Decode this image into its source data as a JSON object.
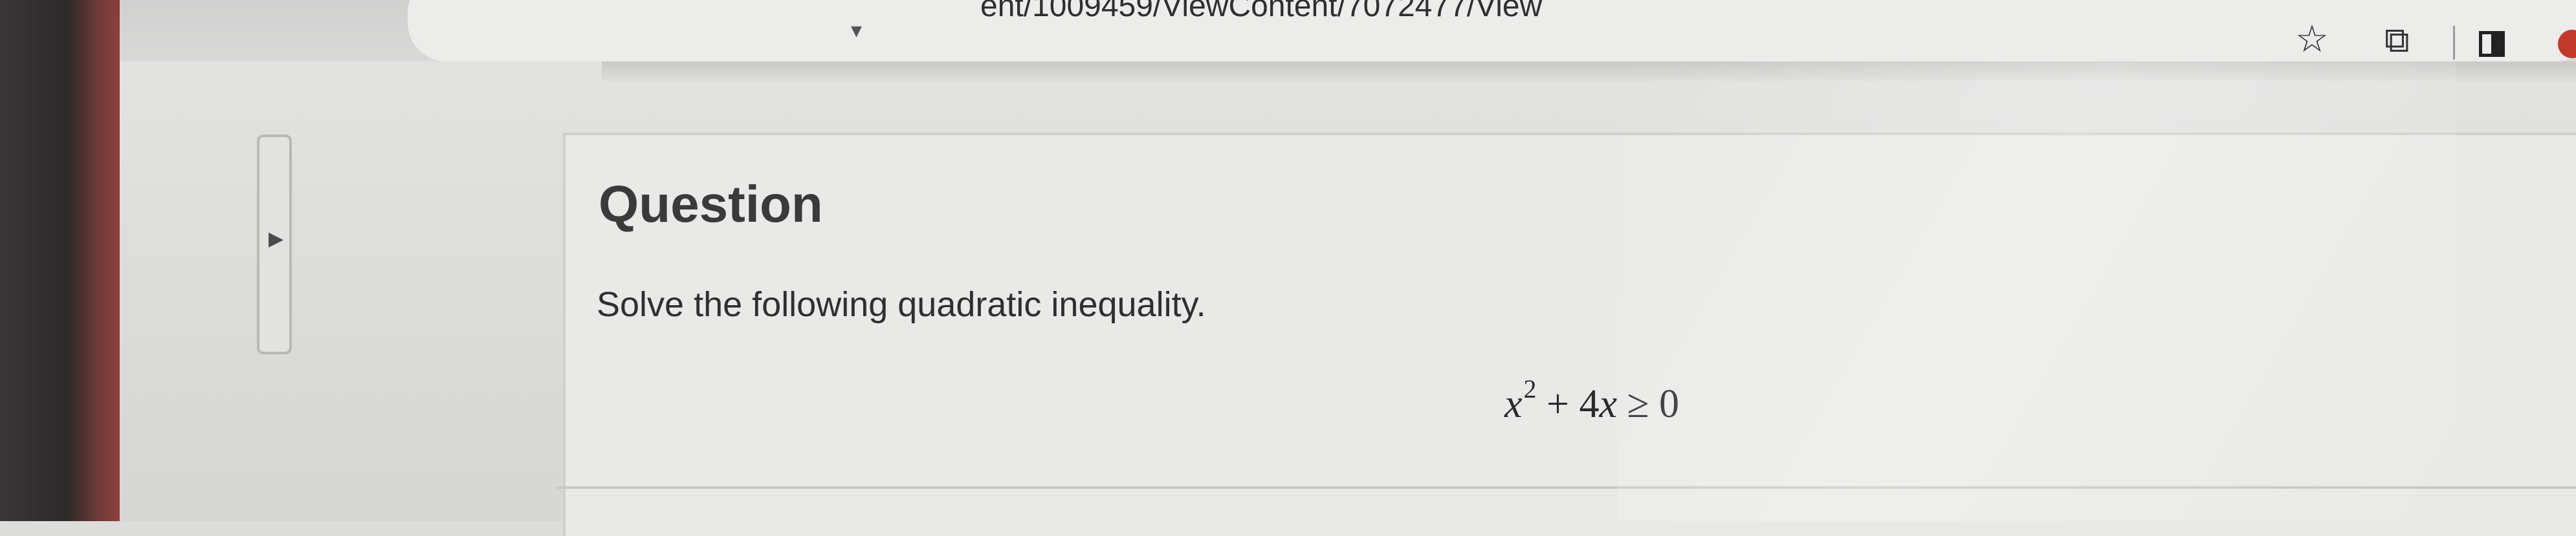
{
  "browser": {
    "url_fragment": "ent/1009459/ViewContent/7072477/View",
    "icons": {
      "bookmark": "star-icon",
      "extensions": "puzzle-icon",
      "side_panel": "side-panel-icon",
      "profile": "profile-icon"
    },
    "profile_color": "#c0392b"
  },
  "page": {
    "section_title": "Question",
    "prompt": "Solve the following quadratic inequality.",
    "expression": {
      "variable": "x",
      "exponent": "2",
      "rest": " + 4",
      "variable2": "x",
      "relation": " ≥ 0"
    }
  }
}
